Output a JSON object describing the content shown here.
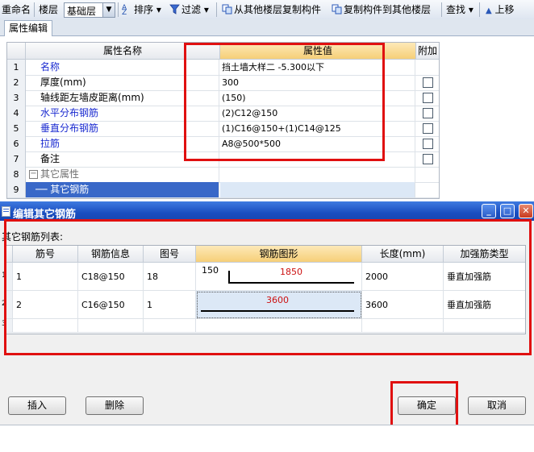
{
  "toolbar": {
    "rename": "重命名",
    "floor_label": "楼层",
    "floor_value": "基础层",
    "sort": "排序",
    "filter": "过滤",
    "copy_from": "从其他楼层复制构件",
    "copy_to": "复制构件到其他楼层",
    "find": "查找",
    "move_up": "上移"
  },
  "panel": {
    "tab": "属性编辑",
    "headers": {
      "name": "属性名称",
      "value": "属性值",
      "extra": "附加"
    },
    "rows": [
      {
        "num": "1",
        "name": "名称",
        "value": "挡土墙大样二  -5.300以下"
      },
      {
        "num": "2",
        "name": "厚度(mm)",
        "value": "300"
      },
      {
        "num": "3",
        "name": "轴线距左墙皮距离(mm)",
        "value": "(150)"
      },
      {
        "num": "4",
        "name": "水平分布钢筋",
        "value": "(2)C12@150"
      },
      {
        "num": "5",
        "name": "垂直分布钢筋",
        "value": "(1)C16@150+(1)C14@125"
      },
      {
        "num": "6",
        "name": "拉筋",
        "value": "A8@500*500"
      },
      {
        "num": "7",
        "name": "备注",
        "value": ""
      },
      {
        "num": "8",
        "name": "其它属性",
        "value": ""
      },
      {
        "num": "9",
        "name": "其它钢筋",
        "value": ""
      }
    ]
  },
  "dialog": {
    "title": "编辑其它钢筋",
    "list_label": "其它钢筋列表:",
    "headers": {
      "no": "筋号",
      "info": "钢筋信息",
      "fig": "图号",
      "shape": "钢筋图形",
      "length": "长度(mm)",
      "type": "加强筋类型"
    },
    "rows": [
      {
        "row": "1",
        "no": "1",
        "info": "C18@150",
        "fig": "18",
        "shape_left": "150",
        "shape_main": "1850",
        "length": "2000",
        "type": "垂直加强筋"
      },
      {
        "row": "2",
        "no": "2",
        "info": "C16@150",
        "fig": "1",
        "shape_left": "",
        "shape_main": "3600",
        "length": "3600",
        "type": "垂直加强筋"
      },
      {
        "row": "3",
        "no": "",
        "info": "",
        "fig": "",
        "shape_left": "",
        "shape_main": "",
        "length": "",
        "type": ""
      }
    ],
    "buttons": {
      "insert": "插入",
      "delete": "删除",
      "ok": "确定",
      "cancel": "取消"
    },
    "controls": {
      "minimize": "_",
      "maximize": "□",
      "close": "✕"
    }
  },
  "colors": {
    "highlight": "#e01010",
    "title_bar": "#1a4ec0",
    "selected": "#3968c8",
    "shape_text": "#cc1010"
  }
}
